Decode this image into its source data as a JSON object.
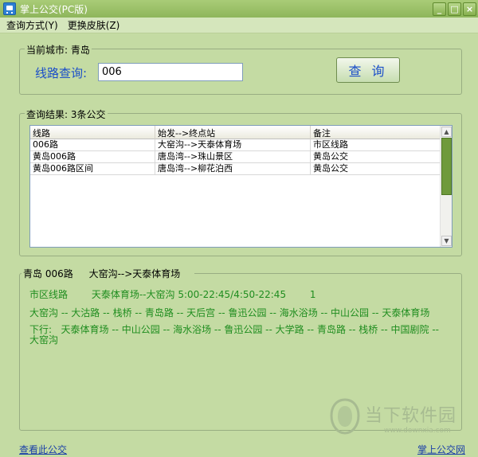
{
  "window": {
    "title": "掌上公交(PC版)",
    "minimize_label": "_",
    "maximize_label": "□",
    "close_label": "×"
  },
  "menu": {
    "items": [
      {
        "label": "查询方式(Y)"
      },
      {
        "label": "更换皮肤(Z)"
      }
    ]
  },
  "query_group": {
    "title": "当前城市: 青岛",
    "route_label": "线路查询:",
    "route_value": "006",
    "query_button": "查 询"
  },
  "results_group": {
    "title": "查询结果: 3条公交",
    "columns": [
      "线路",
      "始发-->终点站",
      "备注"
    ],
    "rows": [
      {
        "route": "006路",
        "stations": "大窑沟-->天泰体育场",
        "note": "市区线路"
      },
      {
        "route": "黄岛006路",
        "stations": "唐岛湾-->珠山景区",
        "note": "黄岛公交"
      },
      {
        "route": "黄岛006路区间",
        "stations": "唐岛湾-->柳花泊西",
        "note": "黄岛公交"
      }
    ]
  },
  "detail": {
    "route": "青岛 006路",
    "endpoints": "大窑沟-->天泰体育场",
    "type": "市区线路",
    "schedule": "天泰体育场--大窑沟 5:00-22:45/4:50-22:45",
    "fare": "1",
    "up_stops": "大窑沟 -- 大沽路 -- 栈桥 -- 青岛路 -- 天后宫 -- 鲁迅公园 -- 海水浴场 -- 中山公园 -- 天泰体育场",
    "down_label": "下行:",
    "down_stops": "天泰体育场 -- 中山公园 -- 海水浴场 -- 鲁迅公园 -- 大学路 -- 青岛路 -- 栈桥 -- 中国剧院 -- 大窑沟"
  },
  "footer": {
    "left_link": "查看此公交",
    "right_link": "掌上公交网"
  },
  "watermark": {
    "name": "当下软件园",
    "url": "www.downxia.com"
  },
  "colors": {
    "background": "#c4dba3",
    "titlebar": "#8eb65b",
    "accent_blue": "#1a4ec9",
    "detail_green": "#1f8d1f",
    "scroll_thumb": "#6f9a3c"
  }
}
